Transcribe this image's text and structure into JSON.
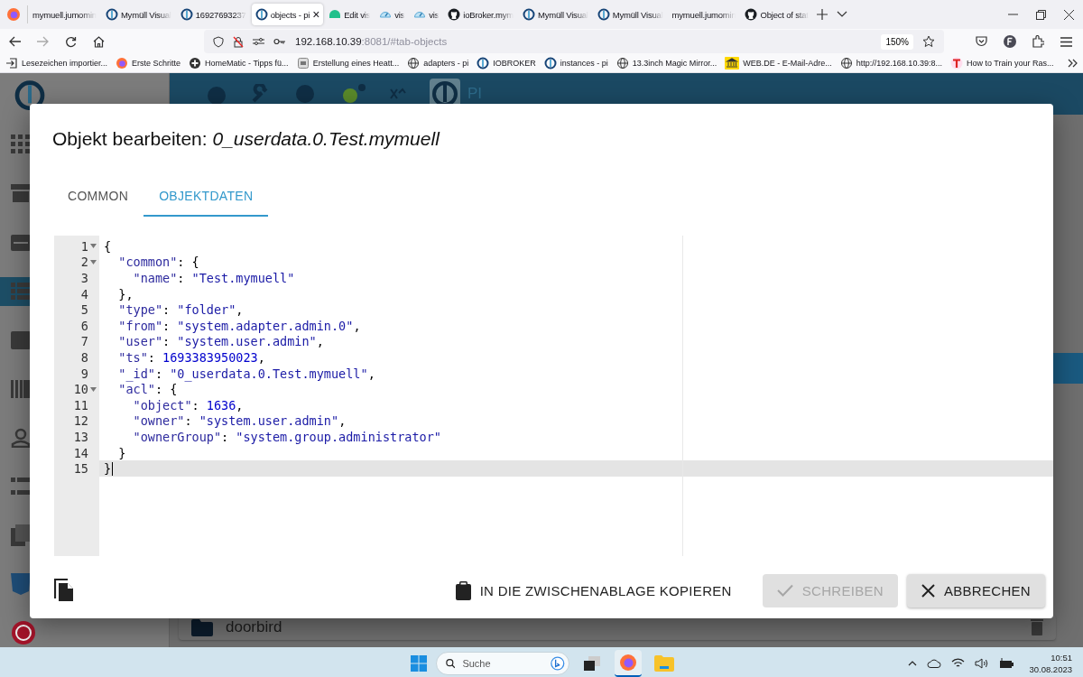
{
  "browser_tabs": [
    {
      "label": "mymuell.jumomin",
      "kind": "none",
      "selected": false
    },
    {
      "label": "Mymüll Visual",
      "kind": "iobroker",
      "selected": false
    },
    {
      "label": "16927693237",
      "kind": "iobroker",
      "selected": false
    },
    {
      "label": "objects - pi",
      "kind": "iobroker",
      "selected": true,
      "close": "×"
    },
    {
      "label": "Edit vis",
      "kind": "edit",
      "selected": false
    },
    {
      "label": "vis",
      "kind": "vis",
      "selected": false
    },
    {
      "label": "vis",
      "kind": "vis",
      "selected": false
    },
    {
      "label": "ioBroker.mym",
      "kind": "github",
      "selected": false
    },
    {
      "label": "Mymüll Visual",
      "kind": "iobroker",
      "selected": false
    },
    {
      "label": "Mymüll Visual",
      "kind": "iobroker",
      "selected": false
    },
    {
      "label": "mymuell.jumomin",
      "kind": "none",
      "selected": false
    },
    {
      "label": "Object of stat",
      "kind": "github",
      "selected": false
    }
  ],
  "address": {
    "host": "192.168.10.39",
    "path": ":8081/#tab-objects",
    "zoom": "150%"
  },
  "bookmarks": [
    {
      "label": "Lesezeichen importier...",
      "kind": "import"
    },
    {
      "label": "Erste Schritte",
      "kind": "firefox"
    },
    {
      "label": "HomeMatic - Tipps fü...",
      "kind": "plus"
    },
    {
      "label": "Erstellung eines Heatt...",
      "kind": "page"
    },
    {
      "label": "adapters - pi",
      "kind": "globe"
    },
    {
      "label": "IOBROKER",
      "kind": "iobroker"
    },
    {
      "label": "instances - pi",
      "kind": "iobroker"
    },
    {
      "label": "13.3inch Magic Mirror...",
      "kind": "globe"
    },
    {
      "label": "WEB.DE - E-Mail-Adre...",
      "kind": "webde"
    },
    {
      "label": "http://192.168.10.39:8...",
      "kind": "globe"
    },
    {
      "label": "How to Train your Ras...",
      "kind": "t"
    }
  ],
  "app": {
    "host_name": "PI",
    "folder_row": "doorbird"
  },
  "dialog": {
    "title": "Objekt bearbeiten: *0_userdata.0.Test.mymuell*",
    "tabs": [
      {
        "label": "COMMON",
        "selected": false
      },
      {
        "label": "OBJEKTDATEN",
        "selected": true
      }
    ],
    "editor_lines": [
      {
        "number": "1",
        "text": "{",
        "fold": true,
        "active": false
      },
      {
        "number": "2",
        "text": "  \"common\": {",
        "fold": true,
        "active": false
      },
      {
        "number": "3",
        "text": "    \"name\": \"Test.mymuell\"",
        "fold": false,
        "active": false
      },
      {
        "number": "4",
        "text": "  },",
        "fold": false,
        "active": false
      },
      {
        "number": "5",
        "text": "  \"type\": \"folder\",",
        "fold": false,
        "active": false
      },
      {
        "number": "6",
        "text": "  \"from\": \"system.adapter.admin.0\",",
        "fold": false,
        "active": false
      },
      {
        "number": "7",
        "text": "  \"user\": \"system.user.admin\",",
        "fold": false,
        "active": false
      },
      {
        "number": "8",
        "text": "  \"ts\": 1693383950023,",
        "fold": false,
        "active": false
      },
      {
        "number": "9",
        "text": "  \"_id\": \"0_userdata.0.Test.mymuell\",",
        "fold": false,
        "active": false
      },
      {
        "number": "10",
        "text": "  \"acl\": {",
        "fold": true,
        "active": false
      },
      {
        "number": "11",
        "text": "    \"object\": 1636,",
        "fold": false,
        "active": false
      },
      {
        "number": "12",
        "text": "    \"owner\": \"system.user.admin\",",
        "fold": false,
        "active": false
      },
      {
        "number": "13",
        "text": "    \"ownerGroup\": \"system.group.administrator\"",
        "fold": false,
        "active": false
      },
      {
        "number": "14",
        "text": "  }",
        "fold": false,
        "active": false
      },
      {
        "number": "15",
        "text": "}",
        "fold": false,
        "active": true
      }
    ],
    "buttons": [
      {
        "label": "IN DIE ZWISCHENABLAGE KOPIEREN",
        "kind": "copy",
        "disabled": false
      },
      {
        "label": "SCHREIBEN",
        "kind": "write",
        "disabled": true
      },
      {
        "label": "ABBRECHEN",
        "kind": "cancel",
        "disabled": false
      }
    ]
  },
  "taskbar": {
    "search_placeholder": "Suche",
    "time": "10:51",
    "date": "30.08.2023"
  }
}
